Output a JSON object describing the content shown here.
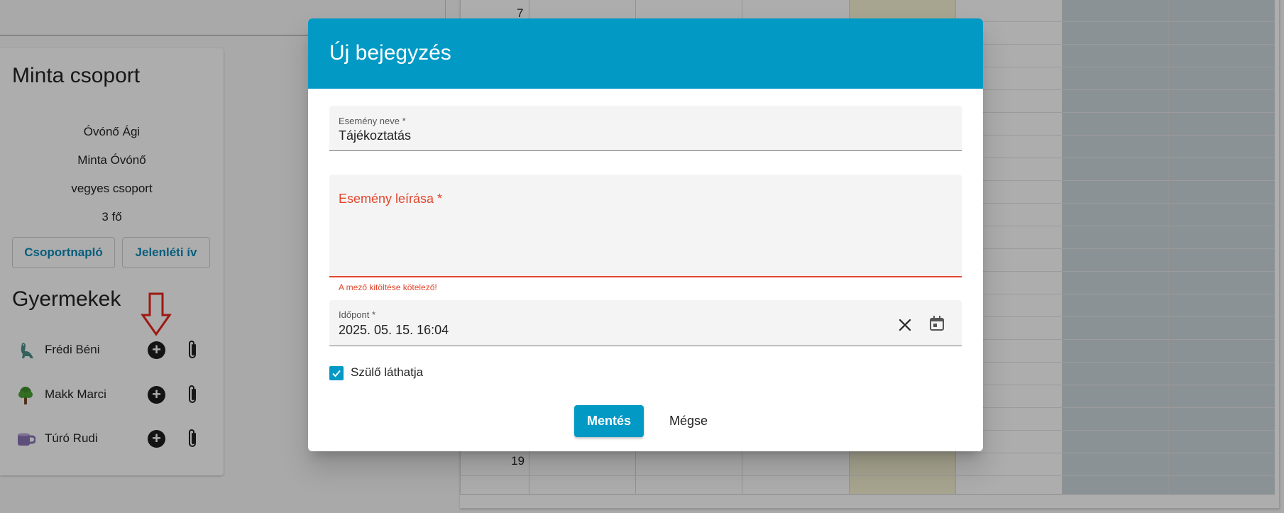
{
  "group": {
    "title": "Minta csoport",
    "teacher": "Óvónő Ági",
    "assistant": "Minta Óvónő",
    "type": "vegyes csoport",
    "count": "3 fő",
    "log_button": "Csoportnapló",
    "attendance_button": "Jelenléti ív"
  },
  "children": {
    "title": "Gyermekek",
    "items": [
      {
        "name": "Frédi Béni",
        "avatar": "dinosaur-icon"
      },
      {
        "name": "Makk Marci",
        "avatar": "tree-icon"
      },
      {
        "name": "Túró Rudi",
        "avatar": "mug-icon"
      }
    ]
  },
  "calendar": {
    "hours": [
      "7",
      "19"
    ]
  },
  "dialog": {
    "title": "Új bejegyzés",
    "event_name_label": "Esemény neve *",
    "event_name_value": "Tájékoztatás",
    "description_label": "Esemény leírása *",
    "description_error": "A mező kitöltése kötelező!",
    "time_label": "Időpont *",
    "time_value": "2025. 05. 15. 16:04",
    "parent_visible_label": "Szülő láthatja",
    "parent_visible_checked": true,
    "save_label": "Mentés",
    "cancel_label": "Mégse"
  },
  "colors": {
    "accent": "#0299c5",
    "error": "#e2462c",
    "highlight_column": "#f6f3d3",
    "weekend_column": "#cdd8de"
  }
}
